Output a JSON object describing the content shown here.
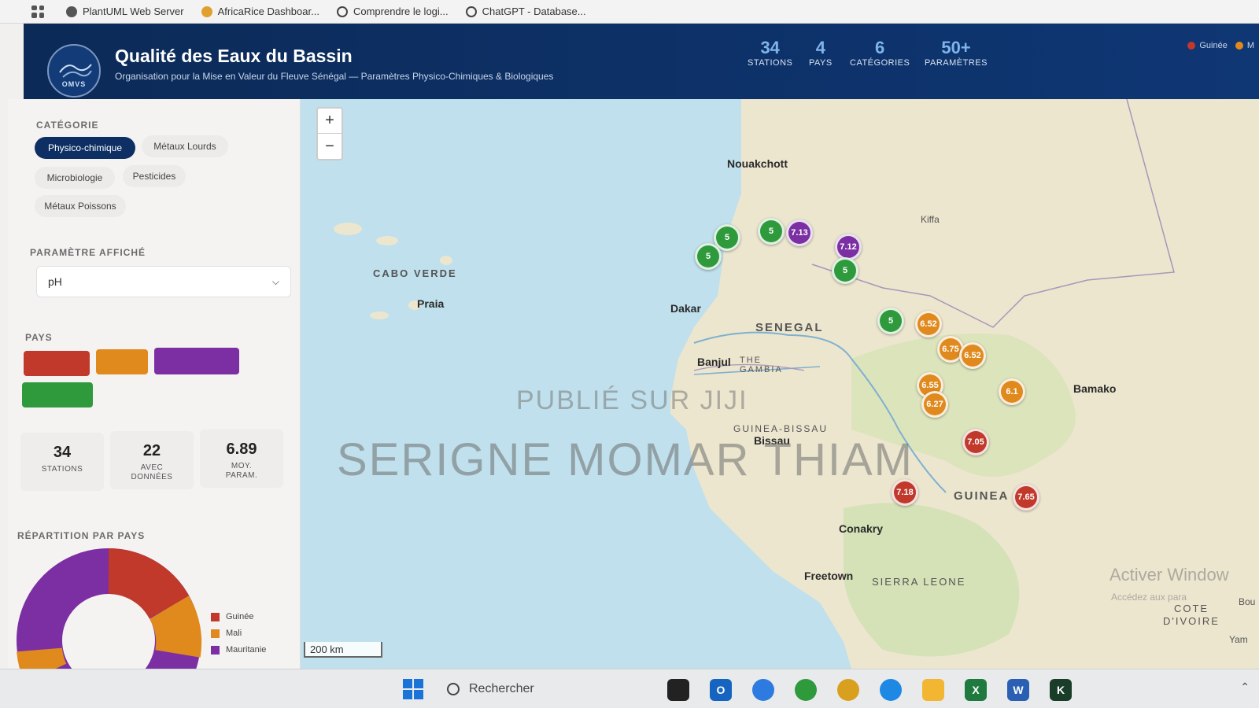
{
  "browser": {
    "bookmarks": [
      {
        "label": "PlantUML Web Server",
        "icon": "plantuml-icon",
        "color": "#555555"
      },
      {
        "label": "AfricaRice Dashboar...",
        "icon": "africarice-icon",
        "color": "#e0a030"
      },
      {
        "label": "Comprendre le logi...",
        "icon": "openai-icon",
        "color": "#444444"
      },
      {
        "label": "ChatGPT - Database...",
        "icon": "openai-icon",
        "color": "#444444"
      }
    ]
  },
  "header": {
    "logo_text": "OMVS",
    "title": "Qualité des Eaux du Bassin",
    "subtitle": "Organisation pour la Mise en Valeur du Fleuve Sénégal — Paramètres Physico-Chimiques & Biologiques",
    "stats": [
      {
        "value": "34",
        "label": "STATIONS"
      },
      {
        "value": "4",
        "label": "PAYS"
      },
      {
        "value": "6",
        "label": "CATÉGORIES"
      },
      {
        "value": "50+",
        "label": "PARAMÈTRES"
      }
    ],
    "legend": [
      {
        "label": "Guinée",
        "color": "#c0392b"
      },
      {
        "label": "M",
        "color": "#e08a1e"
      }
    ]
  },
  "sidebar": {
    "category_title": "CATÉGORIE",
    "categories": [
      {
        "label": "Physico-chimique",
        "active": true
      },
      {
        "label": "Métaux Lourds",
        "active": false
      },
      {
        "label": "Microbiologie",
        "active": false
      },
      {
        "label": "Pesticides",
        "active": false
      },
      {
        "label": "Métaux Poissons",
        "active": false
      }
    ],
    "param_title": "PARAMÈTRE AFFICHÉ",
    "param_value": "pH",
    "country_title": "PAYS",
    "country_colors": [
      "#c0392b",
      "#e08a1e",
      "#7b2fa3",
      "#2e9a3c"
    ],
    "stats": [
      {
        "value": "34",
        "label": "STATIONS"
      },
      {
        "value": "22",
        "label": "AVEC DONNÉES"
      },
      {
        "value": "6.89",
        "label": "MOY. PARAM."
      }
    ],
    "distribution_title": "RÉPARTITION PAR PAYS",
    "distribution_legend": [
      {
        "label": "Guinée",
        "color": "#c0392b"
      },
      {
        "label": "Mali",
        "color": "#e08a1e"
      },
      {
        "label": "Mauritanie",
        "color": "#7b2fa3"
      }
    ]
  },
  "map": {
    "zoom_in": "+",
    "zoom_out": "−",
    "scale": "200 km",
    "places": [
      "Nouakchott",
      "Kiffa",
      "CABO VERDE",
      "Praia",
      "Dakar",
      "SENEGAL",
      "Banjul",
      "THE GAMBIA",
      "GUINEA-BISSAU",
      "Bissau",
      "Bamako",
      "GUINEA",
      "Conakry",
      "Freetown",
      "SIERRA LEONE",
      "COTE D'IVOIRE",
      "Bou",
      "Yam"
    ],
    "markers": [
      {
        "value": "5",
        "color": "#2e9a3c"
      },
      {
        "value": "5",
        "color": "#2e9a3c"
      },
      {
        "value": "5",
        "color": "#2e9a3c"
      },
      {
        "value": "7.13",
        "color": "#7b2fa3"
      },
      {
        "value": "7.12",
        "color": "#7b2fa3"
      },
      {
        "value": "5",
        "color": "#2e9a3c"
      },
      {
        "value": "5",
        "color": "#2e9a3c"
      },
      {
        "value": "6.52",
        "color": "#e08a1e"
      },
      {
        "value": "6.75",
        "color": "#e08a1e"
      },
      {
        "value": "6.52",
        "color": "#e08a1e"
      },
      {
        "value": "6.55",
        "color": "#e08a1e"
      },
      {
        "value": "6.27",
        "color": "#e08a1e"
      },
      {
        "value": "6.1",
        "color": "#e08a1e"
      },
      {
        "value": "7.05",
        "color": "#c0392b"
      },
      {
        "value": "7.18",
        "color": "#c0392b"
      },
      {
        "value": "7.65",
        "color": "#c0392b"
      }
    ],
    "watermark_small": "PUBLIÉ SUR JIJI",
    "watermark_large": "SERIGNE MOMAR THIAM",
    "activation_title": "Activer Window",
    "activation_sub": "Accédez aux para"
  },
  "taskbar": {
    "search_placeholder": "Rechercher"
  }
}
